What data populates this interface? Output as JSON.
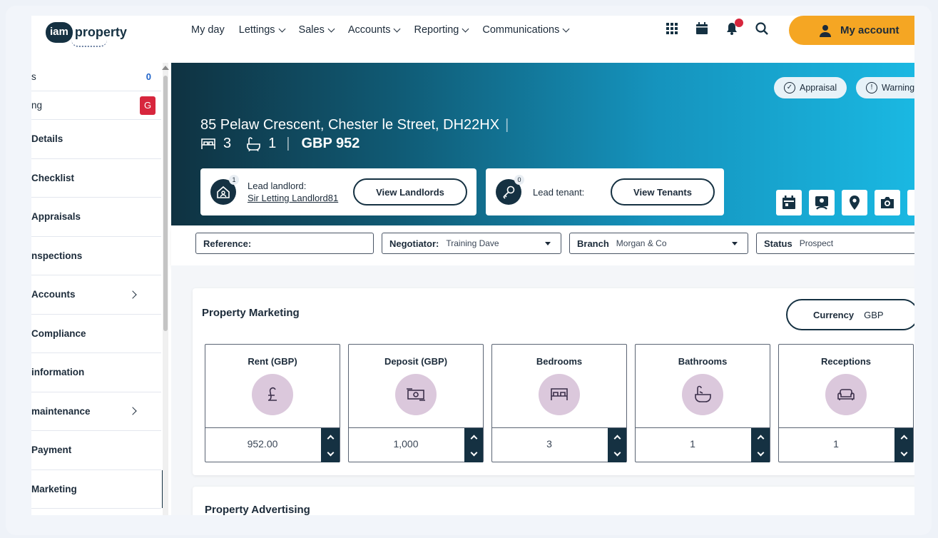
{
  "brand": {
    "logo_badge": "iam",
    "logo_text": "property"
  },
  "nav": {
    "items": [
      {
        "label": "My day",
        "dropdown": false
      },
      {
        "label": "Lettings",
        "dropdown": true
      },
      {
        "label": "Sales",
        "dropdown": true
      },
      {
        "label": "Accounts",
        "dropdown": true
      },
      {
        "label": "Reporting",
        "dropdown": true
      },
      {
        "label": "Communications",
        "dropdown": true
      }
    ],
    "icons": [
      "apps-grid-icon",
      "calendar-icon",
      "bell-icon",
      "search-icon"
    ],
    "account_label": "My account",
    "accent_color": "#f5a623"
  },
  "sidebar": {
    "items": [
      {
        "label": "s",
        "count": "0"
      },
      {
        "label": "ng",
        "badge": "G"
      },
      {
        "label": "Details"
      },
      {
        "label": "Checklist"
      },
      {
        "label": "Appraisals"
      },
      {
        "label": "nspections"
      },
      {
        "label": "Accounts",
        "has_children": true
      },
      {
        "label": "Compliance"
      },
      {
        "label": "information"
      },
      {
        "label": "maintenance",
        "has_children": true
      },
      {
        "label": "Payment"
      },
      {
        "label": "Marketing",
        "active": true
      }
    ]
  },
  "hero": {
    "pills": [
      "Appraisal",
      "Warning"
    ],
    "address": "85 Pelaw Crescent, Chester le Street, DH22HX",
    "bedrooms": "3",
    "bathrooms": "1",
    "price": "GBP 952",
    "landlord": {
      "count": "1",
      "label": "Lead landlord:",
      "name": "Sir Letting Landlord81",
      "button": "View Landlords"
    },
    "tenant": {
      "count": "0",
      "label": "Lead tenant:",
      "button": "View Tenants"
    },
    "actions": [
      "calendar-icon",
      "contact-card-icon",
      "location-pin-icon",
      "camera-icon"
    ],
    "gradient": [
      "#0f3241",
      "#1ab8e2"
    ]
  },
  "filters": {
    "reference": {
      "label": "Reference:",
      "value": ""
    },
    "negotiator": {
      "label": "Negotiator:",
      "value": "Training Dave"
    },
    "branch": {
      "label": "Branch",
      "value": "Morgan & Co"
    },
    "status": {
      "label": "Status",
      "value": "Prospect"
    }
  },
  "marketing": {
    "title": "Property Marketing",
    "currency_label": "Currency",
    "currency_value": "GBP",
    "tiles": [
      {
        "label": "Rent (GBP)",
        "icon": "pound-icon",
        "value": "952.00"
      },
      {
        "label": "Deposit (GBP)",
        "icon": "cash-icon",
        "value": "1,000"
      },
      {
        "label": "Bedrooms",
        "icon": "bed-icon",
        "value": "3"
      },
      {
        "label": "Bathrooms",
        "icon": "bath-icon",
        "value": "1"
      },
      {
        "label": "Receptions",
        "icon": "sofa-icon",
        "value": "1"
      }
    ]
  },
  "advertising": {
    "title": "Property Advertising"
  }
}
